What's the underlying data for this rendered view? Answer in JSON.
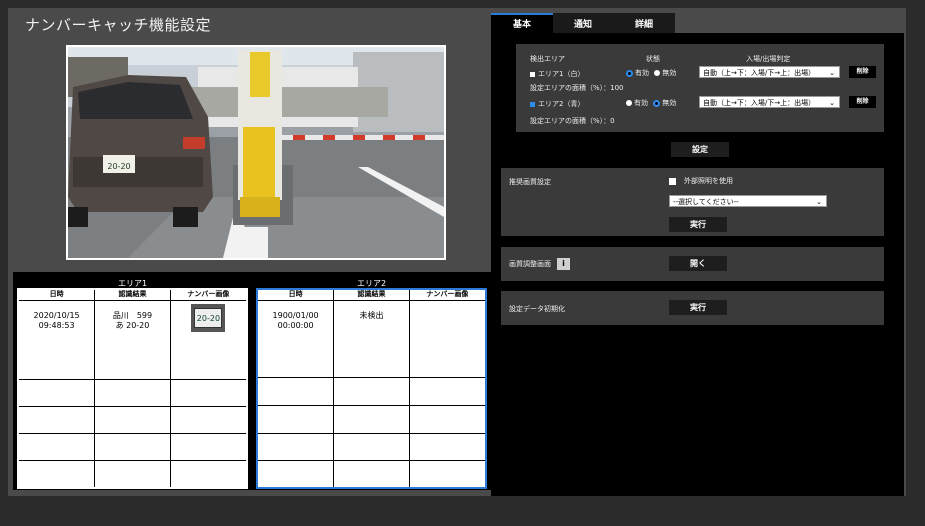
{
  "page_title": "ナンバーキャッチ機能設定",
  "tabs": [
    {
      "label": "基本",
      "active": true
    },
    {
      "label": "通知",
      "active": false
    },
    {
      "label": "詳細",
      "active": false
    }
  ],
  "detection": {
    "col_area": "検出エリア",
    "col_state": "状態",
    "col_judge": "入場/出場判定",
    "areas": [
      {
        "label": "エリア1（白）",
        "color": "#ffffff",
        "enabled_label": "有効",
        "disabled_label": "無効",
        "state": "有効",
        "judge_value": "自動（上→下：入場/下→上：出場）",
        "delete_label": "削除",
        "area_pct_text": "設定エリアの面積（%）：100"
      },
      {
        "label": "エリア2（青）",
        "color": "#2d8ef0",
        "enabled_label": "有効",
        "disabled_label": "無効",
        "state": "無効",
        "judge_value": "自動（上→下：入場/下→上：出場）",
        "delete_label": "削除",
        "area_pct_text": "設定エリアの面積（%）：0"
      }
    ],
    "set_button": "設定"
  },
  "recommended": {
    "label": "推奨画質設定",
    "external_light_label": "外部照明を使用",
    "external_light_checked": false,
    "select_placeholder": "--選択してください--",
    "run_button": "実行"
  },
  "image_adjust": {
    "label": "画質調整画面",
    "info_icon": "i",
    "open_button": "開く"
  },
  "reset": {
    "label": "設定データ初期化",
    "run_button": "実行"
  },
  "results": {
    "area1": {
      "title": "エリア1",
      "headers": [
        "日時",
        "認識結果",
        "ナンバー画像"
      ],
      "rows": [
        {
          "date": "2020/10/15",
          "time": "09:48:53",
          "plate_line1": "品川　599",
          "plate_line2": "あ  20-20",
          "has_image": true,
          "plate_image_text": "20-20"
        },
        {
          "date": "",
          "time": "",
          "plate_line1": "",
          "plate_line2": "",
          "has_image": false
        },
        {
          "date": "",
          "time": "",
          "plate_line1": "",
          "plate_line2": "",
          "has_image": false
        },
        {
          "date": "",
          "time": "",
          "plate_line1": "",
          "plate_line2": "",
          "has_image": false
        },
        {
          "date": "",
          "time": "",
          "plate_line1": "",
          "plate_line2": "",
          "has_image": false
        }
      ]
    },
    "area2": {
      "title": "エリア2",
      "headers": [
        "日時",
        "認識結果",
        "ナンバー画像"
      ],
      "rows": [
        {
          "date": "1900/01/00",
          "time": "00:00:00",
          "plate_line1": "未検出",
          "plate_line2": "",
          "has_image": false
        },
        {
          "date": "",
          "time": "",
          "plate_line1": "",
          "plate_line2": "",
          "has_image": false
        },
        {
          "date": "",
          "time": "",
          "plate_line1": "",
          "plate_line2": "",
          "has_image": false
        },
        {
          "date": "",
          "time": "",
          "plate_line1": "",
          "plate_line2": "",
          "has_image": false
        },
        {
          "date": "",
          "time": "",
          "plate_line1": "",
          "plate_line2": "",
          "has_image": false
        }
      ]
    }
  },
  "camera_plate_text": "20-20"
}
